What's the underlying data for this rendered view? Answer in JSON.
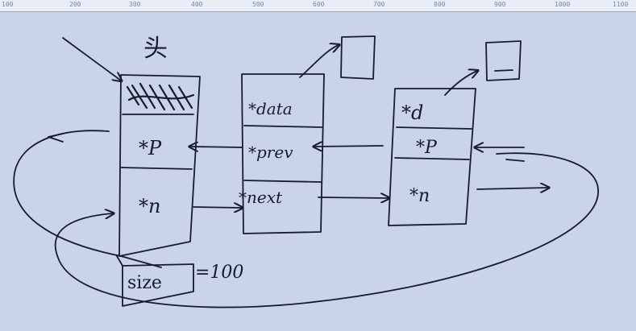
{
  "ruler": {
    "ticks": [
      "100",
      "200",
      "300",
      "400",
      "500",
      "600",
      "700",
      "800",
      "900",
      "1000",
      "1100"
    ]
  },
  "diagram": {
    "head_label": "头",
    "head_node": {
      "fields": [
        "",
        "*P",
        "*n"
      ]
    },
    "node_a": {
      "fields": [
        "*data",
        "*prev",
        "*next"
      ]
    },
    "node_b": {
      "fields": [
        "*d",
        "*P",
        "*n"
      ]
    },
    "size_label": "size",
    "size_value": "=100"
  },
  "colors": {
    "ink": "#1a1a2a",
    "board": "#c9d3ea",
    "ruler": "#e9edf6"
  }
}
